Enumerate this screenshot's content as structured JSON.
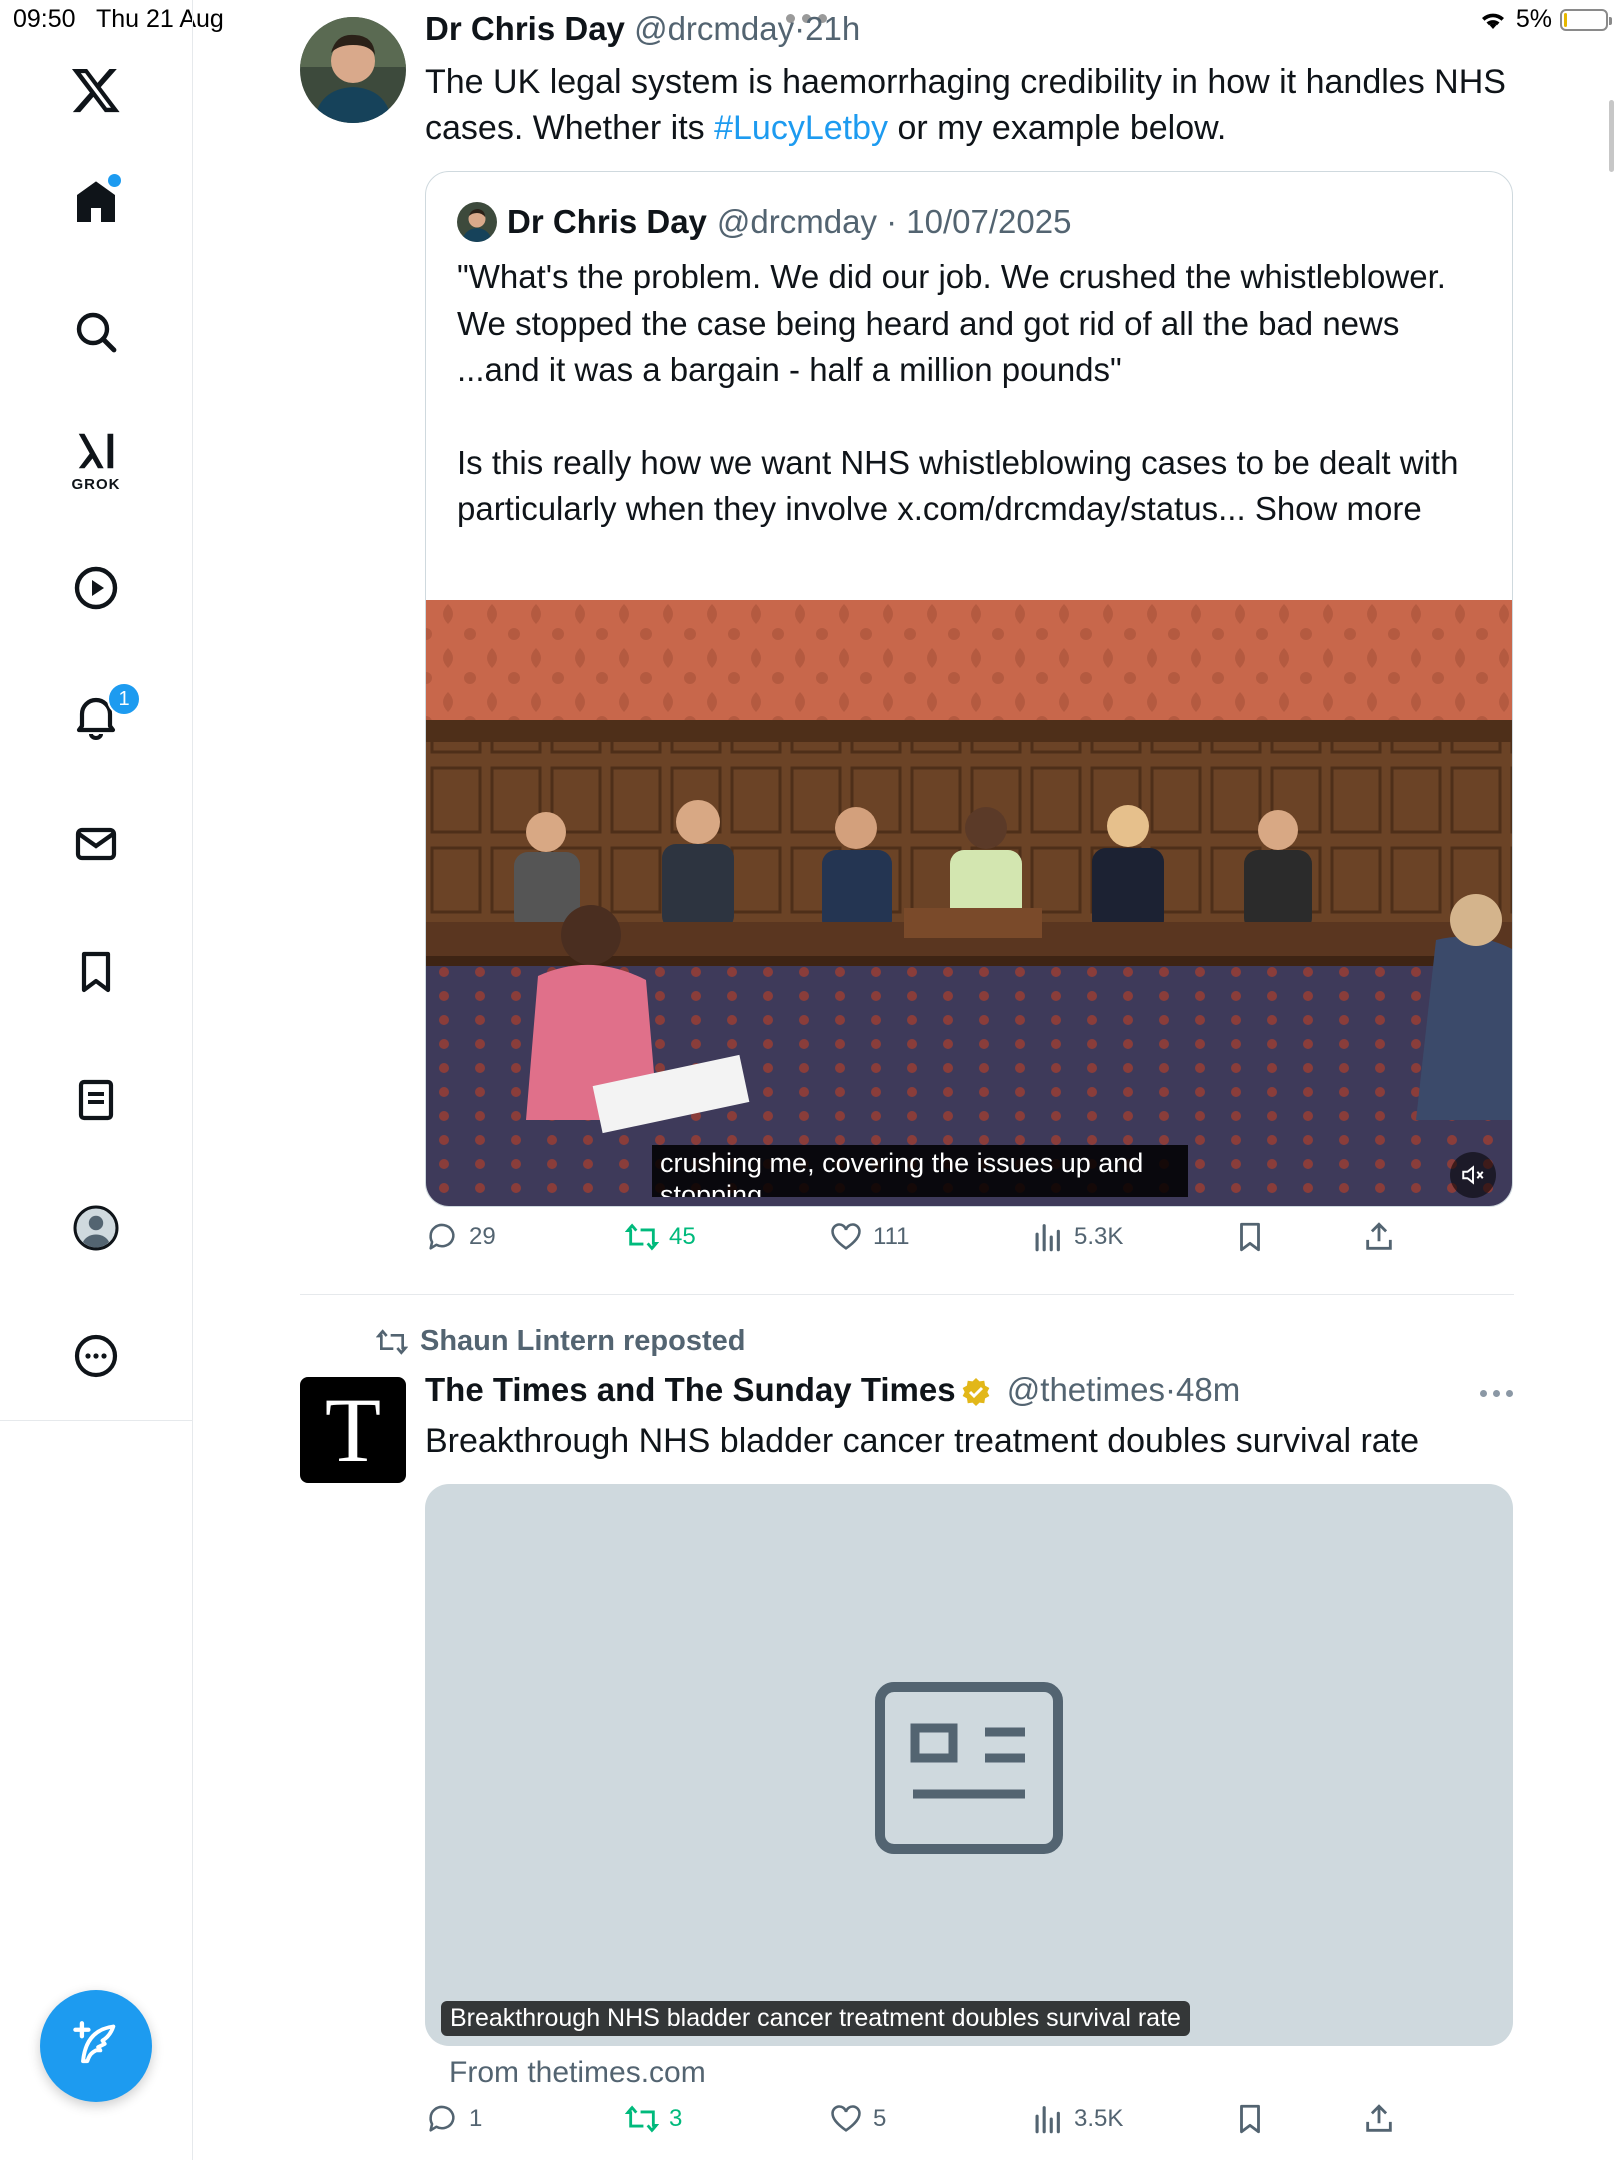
{
  "status_bar": {
    "time": "09:50",
    "date": "Thu 21 Aug",
    "battery": "5%"
  },
  "sidebar": {
    "items": [
      {
        "label": "Home",
        "icon": "home-icon",
        "has_dot": true
      },
      {
        "label": "Search",
        "icon": "search-icon"
      },
      {
        "label": "GROK",
        "icon": "grok-icon"
      },
      {
        "label": "Video",
        "icon": "play-icon"
      },
      {
        "label": "Notifications",
        "icon": "bell-icon",
        "badge": "1"
      },
      {
        "label": "Messages",
        "icon": "mail-icon"
      },
      {
        "label": "Bookmarks",
        "icon": "bookmark-icon"
      },
      {
        "label": "Lists",
        "icon": "list-icon"
      },
      {
        "label": "Profile",
        "icon": "profile-icon"
      },
      {
        "label": "More",
        "icon": "more-icon"
      }
    ],
    "compose_icon": "compose-icon"
  },
  "post1": {
    "author": "Dr Chris Day",
    "handle": "@drcmday",
    "separator": "·",
    "time": "21h",
    "text_before": "The UK legal system  is haemorrhaging credibility in how it handles NHS cases. Whether its ",
    "hashtag": "#LucyLetby",
    "text_after": " or my example below.",
    "quote": {
      "author": "Dr Chris Day",
      "handle": "@drcmday",
      "separator": "·",
      "date": "10/07/2025",
      "para1": "\"What's the problem. We did our job. We crushed the whistleblower. We stopped the case being heard and got rid of all the bad news ...and it was a bargain - half a million pounds\"",
      "para2": "Is this really how we want NHS whistleblowing cases to be dealt with particularly when they involve x.com/drcmday/status... Show more",
      "caption": "crushing me, covering the issues up and stopping"
    },
    "actions": {
      "replies": "29",
      "reposts": "45",
      "likes": "111",
      "views": "5.3K"
    }
  },
  "post2": {
    "reposted_by": "Shaun Lintern reposted",
    "logo_letter": "T",
    "author": "The Times and The Sunday Times",
    "handle": "@thetimes",
    "separator": "·",
    "time": "48m",
    "text": "Breakthrough NHS bladder cancer treatment doubles survival rate",
    "link_card_label": "Breakthrough NHS bladder cancer treatment doubles survival rate",
    "from": "From thetimes.com",
    "actions": {
      "replies": "1",
      "reposts": "3",
      "likes": "5",
      "views": "3.5K"
    }
  },
  "colors": {
    "accent": "#1d9bf0",
    "repost_green": "#00ba7c",
    "muted": "#536471",
    "verified_gold": "#e2b719"
  }
}
